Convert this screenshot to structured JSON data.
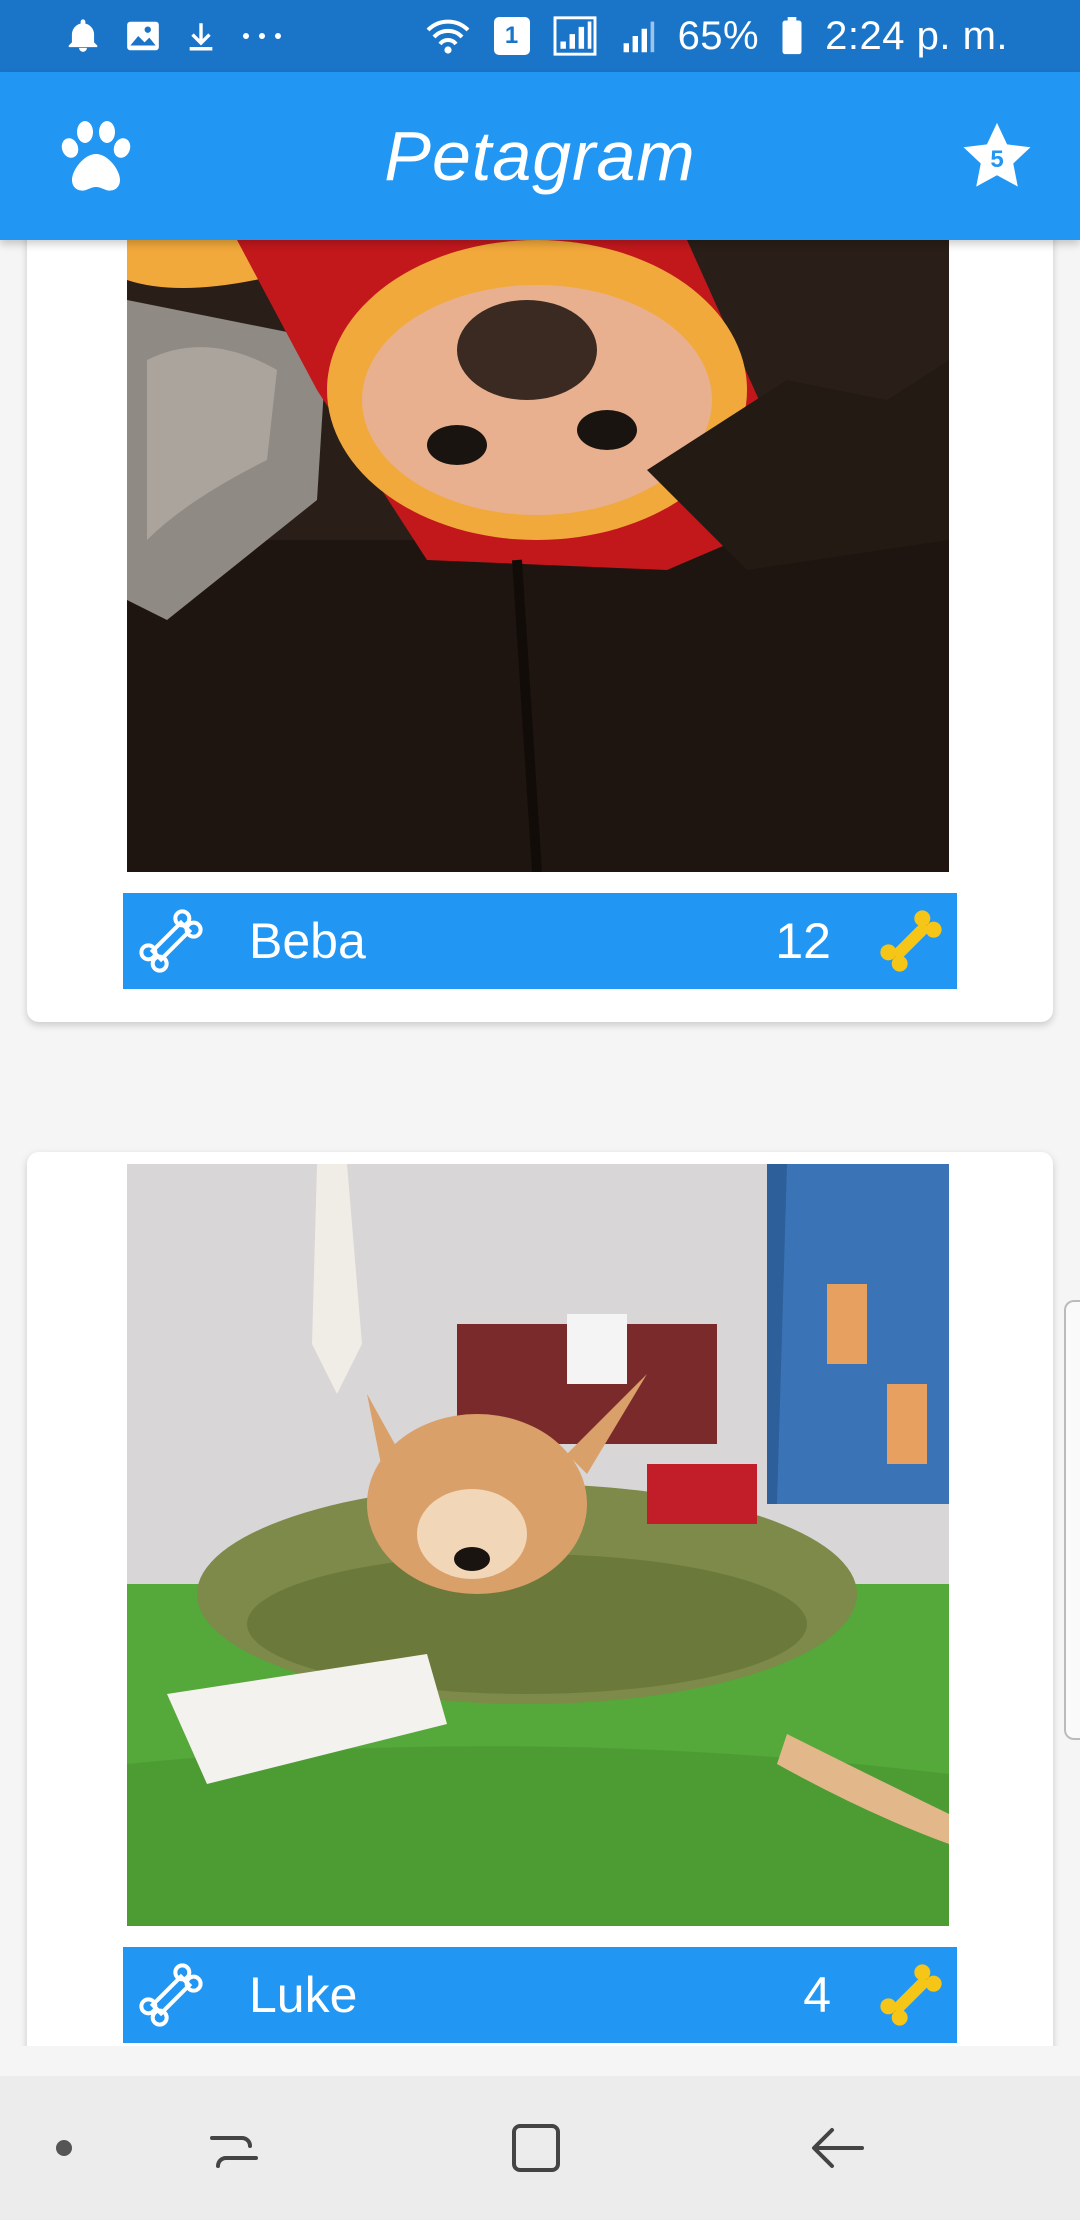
{
  "status_bar": {
    "left_icons": [
      "notification-bell-icon",
      "gallery-icon",
      "download-icon",
      "more-dots-icon"
    ],
    "sim_label": "1",
    "battery": "65%",
    "time": "2:24 p. m."
  },
  "app_bar": {
    "title": "Petagram",
    "left_icon": "paw-icon",
    "favorites_count": "5"
  },
  "pets": [
    {
      "name": "Beba",
      "likes": "12"
    },
    {
      "name": "Luke",
      "likes": "4"
    }
  ],
  "colors": {
    "primary": "#2196f3",
    "primary_dark": "#1a75c8",
    "bone_yellow": "#f5c518"
  },
  "nav_bar": {
    "buttons": [
      "recents-button",
      "home-button",
      "back-button"
    ]
  }
}
